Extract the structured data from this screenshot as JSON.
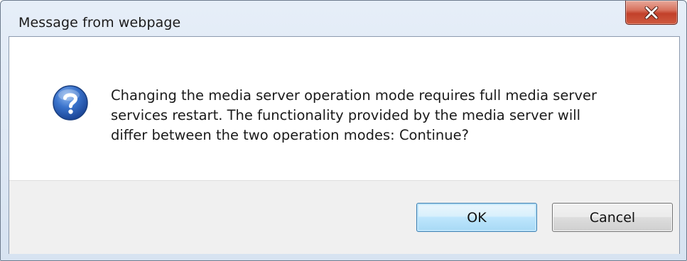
{
  "window": {
    "title": "Message from webpage",
    "close_icon": "close-icon"
  },
  "message": {
    "icon": "question-icon",
    "lines": [
      "Changing the media server operation mode requires full media server",
      "services restart. The functionality provided by the media server will",
      "differ between the two operation modes:  Continue?"
    ]
  },
  "buttons": {
    "ok_label": "OK",
    "cancel_label": "Cancel"
  },
  "colors": {
    "icon_blue": "#2b63b8",
    "close_red": "#c2402a",
    "ok_border": "#3c7fb1"
  }
}
